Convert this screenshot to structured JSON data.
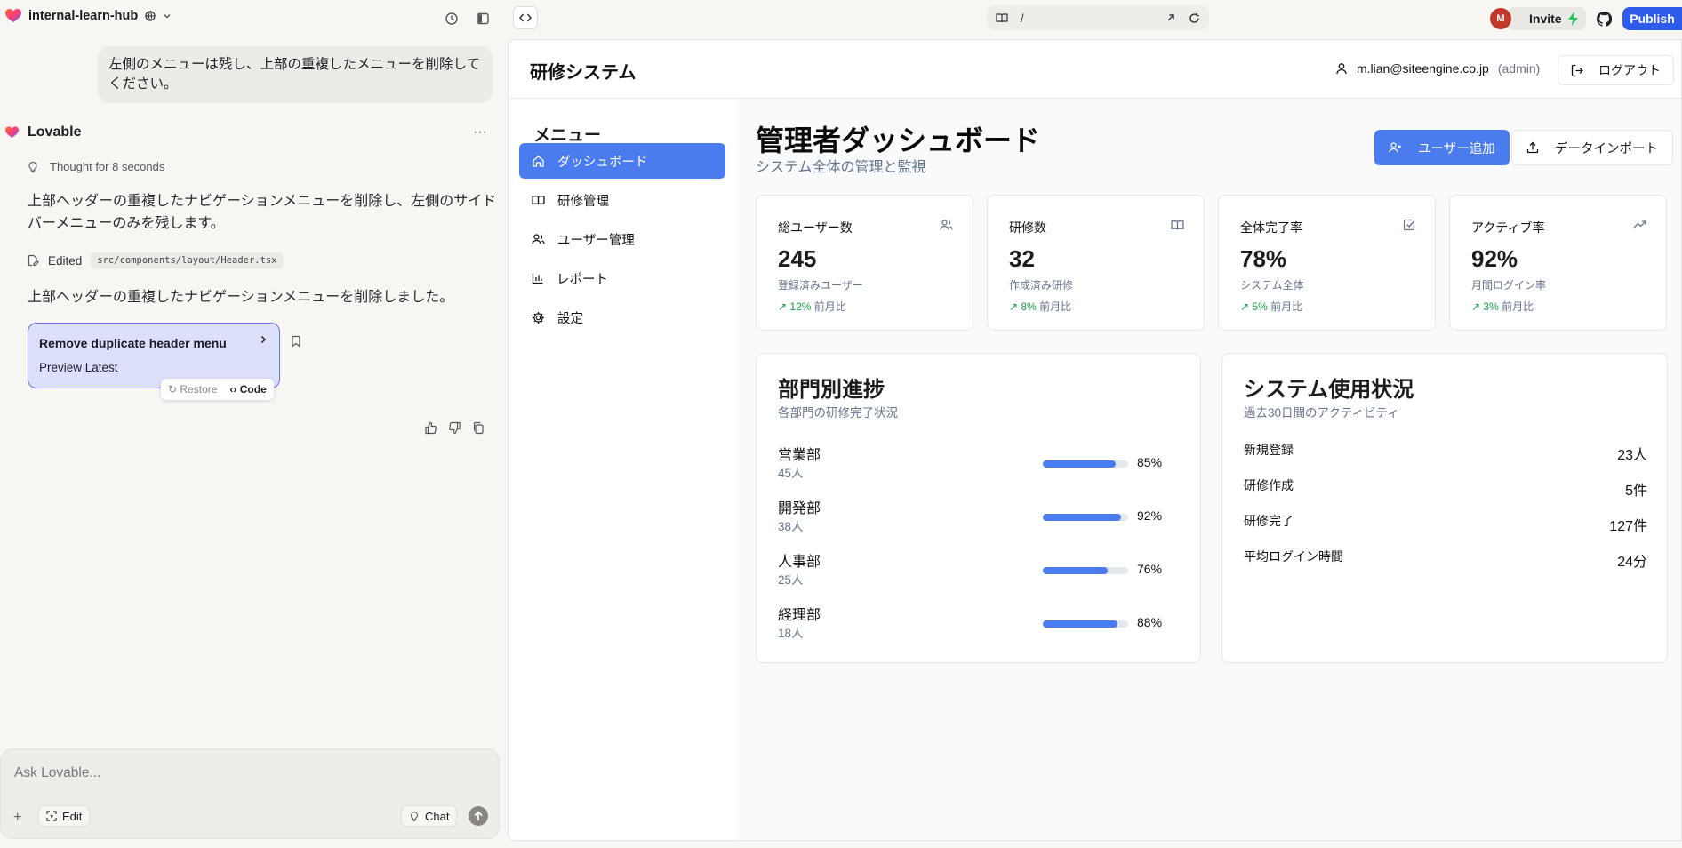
{
  "topbar": {
    "project_name": "internal-learn-hub",
    "url_path": "/",
    "avatar_initials": "M",
    "invite_label": "Invite",
    "publish_label": "Publish"
  },
  "chat": {
    "user_message": "左側のメニューは残し、上部の重複したメニューを削除してください。",
    "assistant_name": "Lovable",
    "more_label": "···",
    "thought_label": "Thought for 8 seconds",
    "response_1": "上部ヘッダーの重複したナビゲーションメニューを削除し、左側のサイドバーメニューのみを残します。",
    "edited_label": "Edited",
    "edited_file": "src/components/layout/Header.tsx",
    "response_2": "上部ヘッダーの重複したナビゲーションメニューを削除しました。",
    "card_title": "Remove duplicate header menu",
    "card_subtitle": "Preview Latest",
    "restore_label": "Restore",
    "code_label": "Code",
    "composer_placeholder": "Ask Lovable...",
    "edit_label": "Edit",
    "chat_label": "Chat"
  },
  "app": {
    "title": "研修システム",
    "user_email": "m.lian@siteengine.co.jp",
    "user_role": "(admin)",
    "logout_label": "ログアウト",
    "menu_title": "メニュー",
    "nav": [
      {
        "label": "ダッシュボード",
        "icon": "home-icon",
        "active": true
      },
      {
        "label": "研修管理",
        "icon": "book-icon",
        "active": false
      },
      {
        "label": "ユーザー管理",
        "icon": "users-icon",
        "active": false
      },
      {
        "label": "レポート",
        "icon": "bar-chart-icon",
        "active": false
      },
      {
        "label": "設定",
        "icon": "gear-icon",
        "active": false
      }
    ],
    "dashboard_title": "管理者ダッシュボード",
    "dashboard_subtitle": "システム全体の管理と監視",
    "add_user_label": "ユーザー追加",
    "import_label": "データインポート",
    "stats": [
      {
        "label": "総ユーザー数",
        "value": "245",
        "desc": "登録済みユーザー",
        "trend": "12%",
        "trend_suffix": "前月比",
        "icon": "users-icon"
      },
      {
        "label": "研修数",
        "value": "32",
        "desc": "作成済み研修",
        "trend": "8%",
        "trend_suffix": "前月比",
        "icon": "book-icon"
      },
      {
        "label": "全体完了率",
        "value": "78%",
        "desc": "システム全体",
        "trend": "5%",
        "trend_suffix": "前月比",
        "icon": "check-square-icon"
      },
      {
        "label": "アクティブ率",
        "value": "92%",
        "desc": "月間ログイン率",
        "trend": "3%",
        "trend_suffix": "前月比",
        "icon": "trending-up-icon"
      }
    ],
    "dept_panel": {
      "title": "部門別進捗",
      "subtitle": "各部門の研修完了状況",
      "departments": [
        {
          "name": "営業部",
          "count": "45人",
          "percent": "85%",
          "progress": 85
        },
        {
          "name": "開発部",
          "count": "38人",
          "percent": "92%",
          "progress": 92
        },
        {
          "name": "人事部",
          "count": "25人",
          "percent": "76%",
          "progress": 76
        },
        {
          "name": "経理部",
          "count": "18人",
          "percent": "88%",
          "progress": 88
        }
      ]
    },
    "usage_panel": {
      "title": "システム使用状況",
      "subtitle": "過去30日間のアクティビティ",
      "rows": [
        {
          "label": "新規登録",
          "value": "23人"
        },
        {
          "label": "研修作成",
          "value": "5件"
        },
        {
          "label": "研修完了",
          "value": "127件"
        },
        {
          "label": "平均ログイン時間",
          "value": "24分"
        }
      ]
    }
  },
  "colors": {
    "accent": "#4a7cf0",
    "publish": "#2f5bea",
    "trend_up": "#16a34a"
  }
}
